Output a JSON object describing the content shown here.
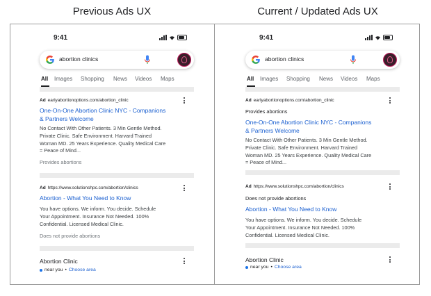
{
  "headings": {
    "left": "Previous Ads UX",
    "right": "Current / Updated Ads UX"
  },
  "phone": {
    "time": "9:41",
    "query": "abortion clinics",
    "tabs": [
      "All",
      "Images",
      "Shopping",
      "News",
      "Videos",
      "Maps"
    ]
  },
  "ad1": {
    "badge": "Ad",
    "url": "earlyabortionoptions.com/abortion_clinic",
    "title_line1": "One-On-One Abortion Clinic NYC - Companions",
    "title_line2": "& Partners Welcome",
    "desc_lines": [
      "No Contact With Other Patients. 3 Min Gentle Method.",
      "Private Clinic. Safe Environment. Harvard Trained",
      "Woman MD. 25 Years Experience. Quality Medical Care",
      "= Peace of Mind..."
    ],
    "disclosure": "Provides abortions"
  },
  "ad2": {
    "badge": "Ad",
    "url": "https://www.solutionshpc.com/abortion/clinics",
    "title": "Abortion - What You Need to Know",
    "desc_lines": [
      "You have options. We inform. You decide. Schedule",
      "Your Appointment. Insurance Not Needed. 100%",
      "Confidential. Licensed Medical Clinic."
    ],
    "disclosure": "Does not provide abortions"
  },
  "local": {
    "title": "Abortion Clinic",
    "near": "near you",
    "bullet": "•",
    "choose": "Choose area"
  },
  "icons": [
    "google-g-icon",
    "microphone-icon",
    "more-vert-icon",
    "signal-icon",
    "wifi-icon",
    "battery-icon"
  ],
  "colors": {
    "link": "#1a5fd0",
    "separator": "#ebebeb",
    "frame": "#9a9a9a"
  }
}
